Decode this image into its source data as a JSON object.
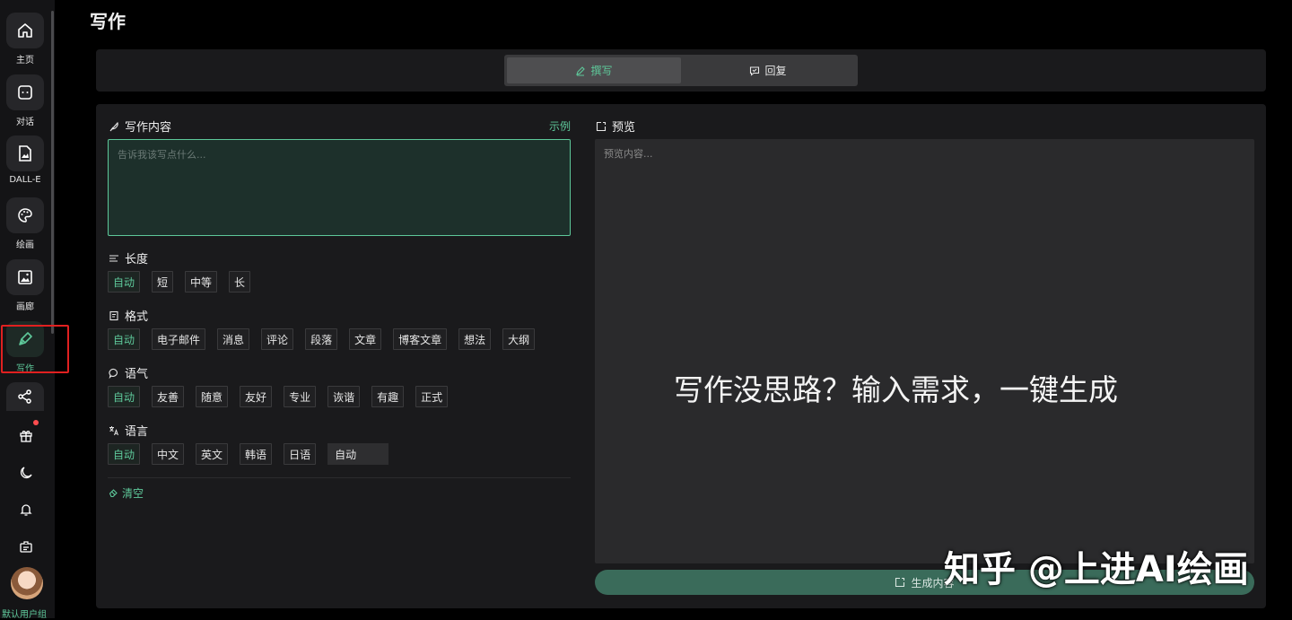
{
  "page": {
    "title": "写作"
  },
  "sidebar": {
    "items": [
      {
        "label": "主页",
        "icon": "home-icon"
      },
      {
        "label": "对话",
        "icon": "chat-icon"
      },
      {
        "label": "DALL-E",
        "icon": "image-plus-icon"
      },
      {
        "label": "绘画",
        "icon": "palette-icon"
      },
      {
        "label": "画廊",
        "icon": "gallery-icon"
      },
      {
        "label": "写作",
        "icon": "pen-icon"
      }
    ],
    "group_label": "默认用户组"
  },
  "tabs": {
    "write": "撰写",
    "reply": "回复"
  },
  "content": {
    "title": "写作内容",
    "example": "示例",
    "placeholder": "告诉我该写点什么..."
  },
  "length": {
    "title": "长度",
    "options": [
      "自动",
      "短",
      "中等",
      "长"
    ]
  },
  "format": {
    "title": "格式",
    "options": [
      "自动",
      "电子邮件",
      "消息",
      "评论",
      "段落",
      "文章",
      "博客文章",
      "想法",
      "大纲"
    ]
  },
  "tone": {
    "title": "语气",
    "options": [
      "自动",
      "友善",
      "随意",
      "友好",
      "专业",
      "诙谐",
      "有趣",
      "正式"
    ]
  },
  "language": {
    "title": "语言",
    "options": [
      "自动",
      "中文",
      "英文",
      "韩语",
      "日语"
    ],
    "select_value": "自动"
  },
  "clear_label": "清空",
  "preview": {
    "title": "预览",
    "placeholder": "预览内容...",
    "generate": "生成内容"
  },
  "overlay_text": "写作没思路？输入需求，一键生成",
  "watermark": "知乎 @上进AI绘画",
  "colors": {
    "accent": "#5ec89a",
    "highlight": "#e02020"
  }
}
